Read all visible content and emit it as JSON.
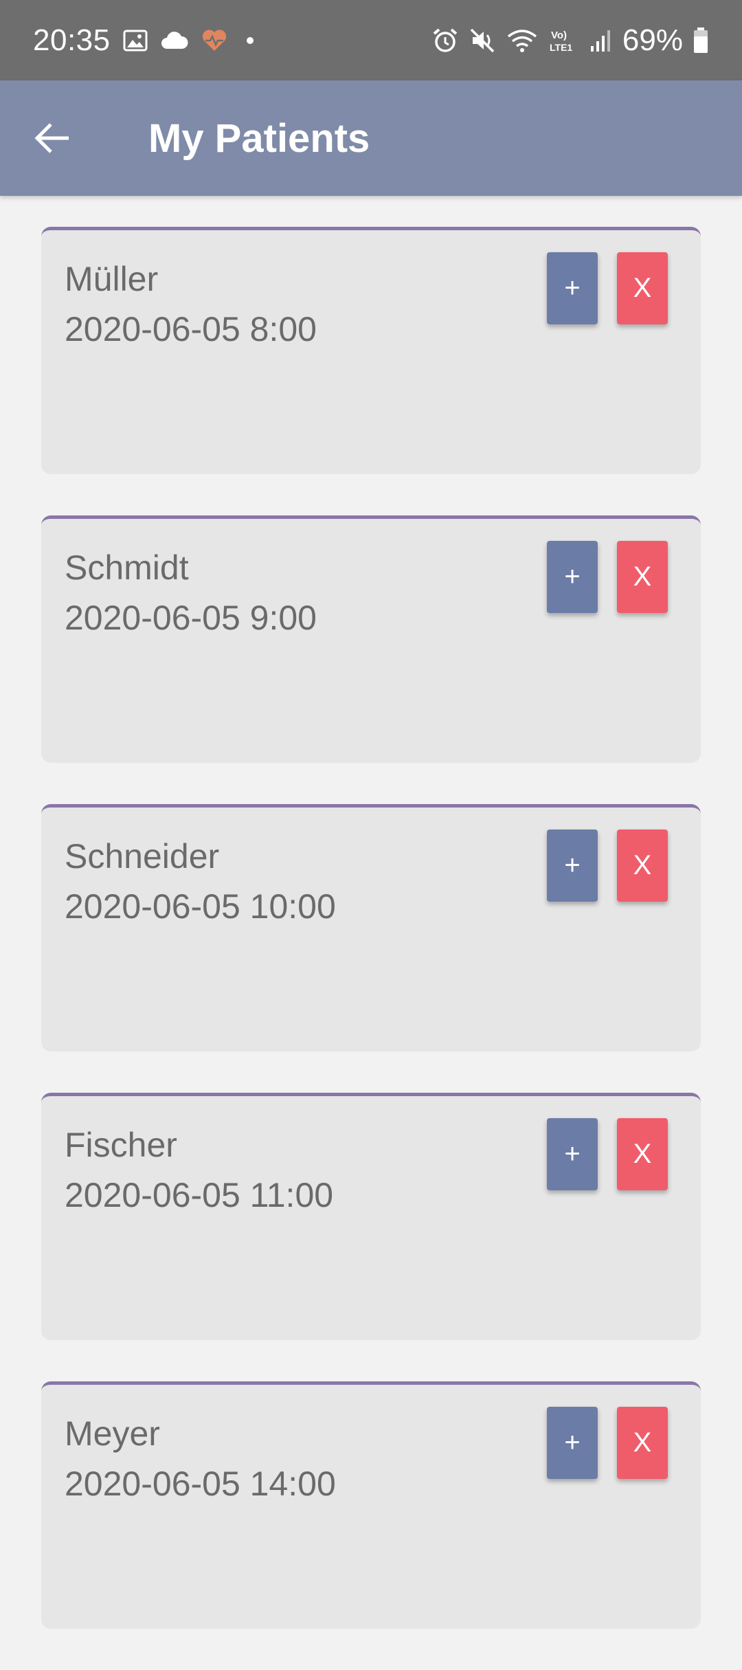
{
  "status_bar": {
    "time": "20:35",
    "battery_percent": "69%",
    "left_icons": [
      "image-icon",
      "cloud-icon",
      "heart-pulse-icon",
      "dot-icon"
    ],
    "right_icons": [
      "alarm-icon",
      "mute-icon",
      "wifi-icon",
      "volte-icon",
      "signal-icon",
      "battery-icon"
    ],
    "volte_label": "Vo) LTE1"
  },
  "app_bar": {
    "title": "My Patients",
    "back_icon": "arrow-left-icon",
    "color": "#7f8ba8"
  },
  "patients": [
    {
      "name": "Müller",
      "datetime": "2020-06-05 8:00",
      "add_label": "+",
      "remove_label": "X"
    },
    {
      "name": "Schmidt",
      "datetime": "2020-06-05 9:00",
      "add_label": "+",
      "remove_label": "X"
    },
    {
      "name": "Schneider",
      "datetime": "2020-06-05 10:00",
      "add_label": "+",
      "remove_label": "X"
    },
    {
      "name": "Fischer",
      "datetime": "2020-06-05 11:00",
      "add_label": "+",
      "remove_label": "X"
    },
    {
      "name": "Meyer",
      "datetime": "2020-06-05 14:00",
      "add_label": "+",
      "remove_label": "X"
    }
  ],
  "colors": {
    "status_bar": "#6e6e6e",
    "background": "#f2f2f2",
    "card": "#e6e6e6",
    "card_accent": "#8a76a8",
    "add_button": "#6b7ca6",
    "remove_button": "#ef5d6b",
    "heart_icon": "#e0865e"
  }
}
